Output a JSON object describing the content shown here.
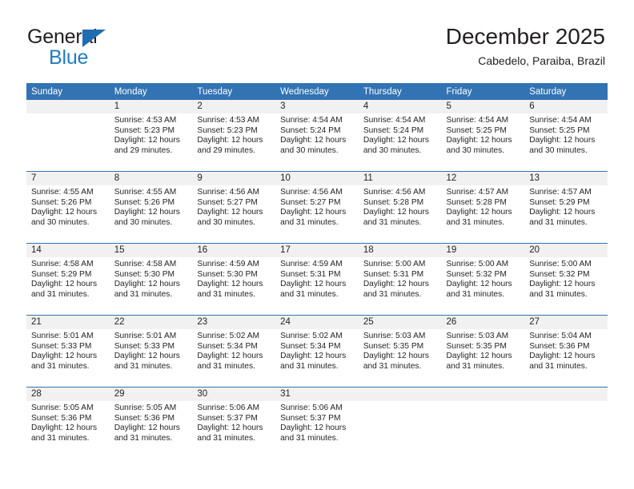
{
  "brand": {
    "line1": "General",
    "line2": "Blue",
    "accent_color": "#1f7dc4",
    "triangle_color": "#1f6cb0"
  },
  "header": {
    "title": "December 2025",
    "subtitle": "Cabedelo, Paraiba, Brazil"
  },
  "calendar": {
    "header_bg": "#3273b3",
    "daynum_bg": "#f1f1f1",
    "weekday_names": [
      "Sunday",
      "Monday",
      "Tuesday",
      "Wednesday",
      "Thursday",
      "Friday",
      "Saturday"
    ],
    "weeks": [
      [
        {
          "day": "",
          "lines": []
        },
        {
          "day": "1",
          "lines": [
            "Sunrise: 4:53 AM",
            "Sunset: 5:23 PM",
            "Daylight: 12 hours",
            "and 29 minutes."
          ]
        },
        {
          "day": "2",
          "lines": [
            "Sunrise: 4:53 AM",
            "Sunset: 5:23 PM",
            "Daylight: 12 hours",
            "and 29 minutes."
          ]
        },
        {
          "day": "3",
          "lines": [
            "Sunrise: 4:54 AM",
            "Sunset: 5:24 PM",
            "Daylight: 12 hours",
            "and 30 minutes."
          ]
        },
        {
          "day": "4",
          "lines": [
            "Sunrise: 4:54 AM",
            "Sunset: 5:24 PM",
            "Daylight: 12 hours",
            "and 30 minutes."
          ]
        },
        {
          "day": "5",
          "lines": [
            "Sunrise: 4:54 AM",
            "Sunset: 5:25 PM",
            "Daylight: 12 hours",
            "and 30 minutes."
          ]
        },
        {
          "day": "6",
          "lines": [
            "Sunrise: 4:54 AM",
            "Sunset: 5:25 PM",
            "Daylight: 12 hours",
            "and 30 minutes."
          ]
        }
      ],
      [
        {
          "day": "7",
          "lines": [
            "Sunrise: 4:55 AM",
            "Sunset: 5:26 PM",
            "Daylight: 12 hours",
            "and 30 minutes."
          ]
        },
        {
          "day": "8",
          "lines": [
            "Sunrise: 4:55 AM",
            "Sunset: 5:26 PM",
            "Daylight: 12 hours",
            "and 30 minutes."
          ]
        },
        {
          "day": "9",
          "lines": [
            "Sunrise: 4:56 AM",
            "Sunset: 5:27 PM",
            "Daylight: 12 hours",
            "and 30 minutes."
          ]
        },
        {
          "day": "10",
          "lines": [
            "Sunrise: 4:56 AM",
            "Sunset: 5:27 PM",
            "Daylight: 12 hours",
            "and 31 minutes."
          ]
        },
        {
          "day": "11",
          "lines": [
            "Sunrise: 4:56 AM",
            "Sunset: 5:28 PM",
            "Daylight: 12 hours",
            "and 31 minutes."
          ]
        },
        {
          "day": "12",
          "lines": [
            "Sunrise: 4:57 AM",
            "Sunset: 5:28 PM",
            "Daylight: 12 hours",
            "and 31 minutes."
          ]
        },
        {
          "day": "13",
          "lines": [
            "Sunrise: 4:57 AM",
            "Sunset: 5:29 PM",
            "Daylight: 12 hours",
            "and 31 minutes."
          ]
        }
      ],
      [
        {
          "day": "14",
          "lines": [
            "Sunrise: 4:58 AM",
            "Sunset: 5:29 PM",
            "Daylight: 12 hours",
            "and 31 minutes."
          ]
        },
        {
          "day": "15",
          "lines": [
            "Sunrise: 4:58 AM",
            "Sunset: 5:30 PM",
            "Daylight: 12 hours",
            "and 31 minutes."
          ]
        },
        {
          "day": "16",
          "lines": [
            "Sunrise: 4:59 AM",
            "Sunset: 5:30 PM",
            "Daylight: 12 hours",
            "and 31 minutes."
          ]
        },
        {
          "day": "17",
          "lines": [
            "Sunrise: 4:59 AM",
            "Sunset: 5:31 PM",
            "Daylight: 12 hours",
            "and 31 minutes."
          ]
        },
        {
          "day": "18",
          "lines": [
            "Sunrise: 5:00 AM",
            "Sunset: 5:31 PM",
            "Daylight: 12 hours",
            "and 31 minutes."
          ]
        },
        {
          "day": "19",
          "lines": [
            "Sunrise: 5:00 AM",
            "Sunset: 5:32 PM",
            "Daylight: 12 hours",
            "and 31 minutes."
          ]
        },
        {
          "day": "20",
          "lines": [
            "Sunrise: 5:00 AM",
            "Sunset: 5:32 PM",
            "Daylight: 12 hours",
            "and 31 minutes."
          ]
        }
      ],
      [
        {
          "day": "21",
          "lines": [
            "Sunrise: 5:01 AM",
            "Sunset: 5:33 PM",
            "Daylight: 12 hours",
            "and 31 minutes."
          ]
        },
        {
          "day": "22",
          "lines": [
            "Sunrise: 5:01 AM",
            "Sunset: 5:33 PM",
            "Daylight: 12 hours",
            "and 31 minutes."
          ]
        },
        {
          "day": "23",
          "lines": [
            "Sunrise: 5:02 AM",
            "Sunset: 5:34 PM",
            "Daylight: 12 hours",
            "and 31 minutes."
          ]
        },
        {
          "day": "24",
          "lines": [
            "Sunrise: 5:02 AM",
            "Sunset: 5:34 PM",
            "Daylight: 12 hours",
            "and 31 minutes."
          ]
        },
        {
          "day": "25",
          "lines": [
            "Sunrise: 5:03 AM",
            "Sunset: 5:35 PM",
            "Daylight: 12 hours",
            "and 31 minutes."
          ]
        },
        {
          "day": "26",
          "lines": [
            "Sunrise: 5:03 AM",
            "Sunset: 5:35 PM",
            "Daylight: 12 hours",
            "and 31 minutes."
          ]
        },
        {
          "day": "27",
          "lines": [
            "Sunrise: 5:04 AM",
            "Sunset: 5:36 PM",
            "Daylight: 12 hours",
            "and 31 minutes."
          ]
        }
      ],
      [
        {
          "day": "28",
          "lines": [
            "Sunrise: 5:05 AM",
            "Sunset: 5:36 PM",
            "Daylight: 12 hours",
            "and 31 minutes."
          ]
        },
        {
          "day": "29",
          "lines": [
            "Sunrise: 5:05 AM",
            "Sunset: 5:36 PM",
            "Daylight: 12 hours",
            "and 31 minutes."
          ]
        },
        {
          "day": "30",
          "lines": [
            "Sunrise: 5:06 AM",
            "Sunset: 5:37 PM",
            "Daylight: 12 hours",
            "and 31 minutes."
          ]
        },
        {
          "day": "31",
          "lines": [
            "Sunrise: 5:06 AM",
            "Sunset: 5:37 PM",
            "Daylight: 12 hours",
            "and 31 minutes."
          ]
        },
        {
          "day": "",
          "lines": []
        },
        {
          "day": "",
          "lines": []
        },
        {
          "day": "",
          "lines": []
        }
      ]
    ]
  }
}
